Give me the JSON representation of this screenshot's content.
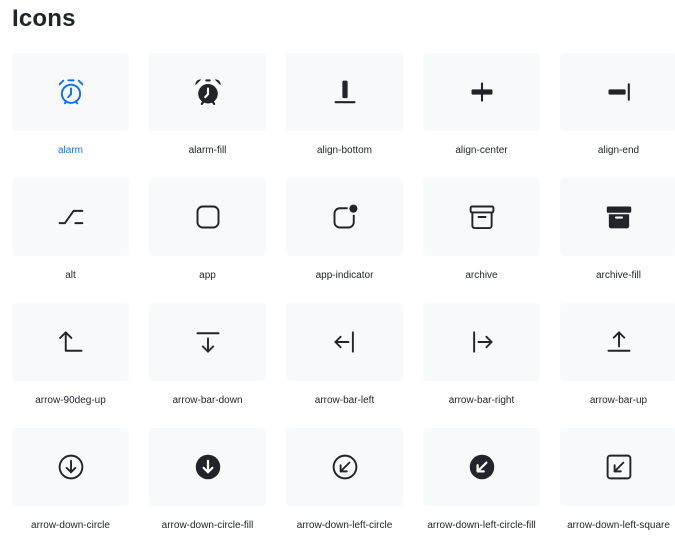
{
  "heading": "Icons",
  "accent_color": "#0d6efd",
  "icons": [
    {
      "label": "alarm",
      "icon": "alarm-icon",
      "active": true
    },
    {
      "label": "alarm-fill",
      "icon": "alarm-fill-icon"
    },
    {
      "label": "align-bottom",
      "icon": "align-bottom-icon"
    },
    {
      "label": "align-center",
      "icon": "align-center-icon"
    },
    {
      "label": "align-end",
      "icon": "align-end-icon"
    },
    {
      "label": "alt",
      "icon": "alt-icon"
    },
    {
      "label": "app",
      "icon": "app-icon"
    },
    {
      "label": "app-indicator",
      "icon": "app-indicator-icon"
    },
    {
      "label": "archive",
      "icon": "archive-icon"
    },
    {
      "label": "archive-fill",
      "icon": "archive-fill-icon"
    },
    {
      "label": "arrow-90deg-up",
      "icon": "arrow-90deg-up-icon"
    },
    {
      "label": "arrow-bar-down",
      "icon": "arrow-bar-down-icon"
    },
    {
      "label": "arrow-bar-left",
      "icon": "arrow-bar-left-icon"
    },
    {
      "label": "arrow-bar-right",
      "icon": "arrow-bar-right-icon"
    },
    {
      "label": "arrow-bar-up",
      "icon": "arrow-bar-up-icon"
    },
    {
      "label": "arrow-down-circle",
      "icon": "arrow-down-circle-icon"
    },
    {
      "label": "arrow-down-circle-fill",
      "icon": "arrow-down-circle-fill-icon"
    },
    {
      "label": "arrow-down-left-circle",
      "icon": "arrow-down-left-circle-icon"
    },
    {
      "label": "arrow-down-left-circle-fill",
      "icon": "arrow-down-left-circle-fill-icon"
    },
    {
      "label": "arrow-down-left-square",
      "icon": "arrow-down-left-square-icon"
    }
  ]
}
